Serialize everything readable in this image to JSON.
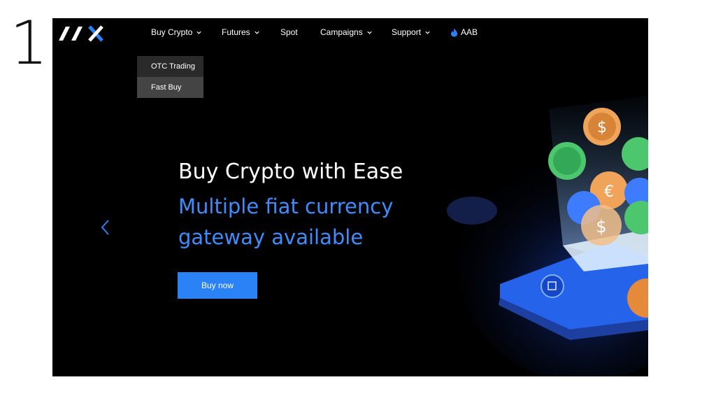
{
  "slide": {
    "number": "1"
  },
  "brand": {
    "name": "AAX"
  },
  "nav": {
    "items": [
      {
        "label": "Buy Crypto",
        "has_dropdown": true
      },
      {
        "label": "Futures",
        "has_dropdown": true
      },
      {
        "label": "Spot",
        "has_dropdown": false
      },
      {
        "label": "Campaigns",
        "has_dropdown": true
      },
      {
        "label": "Support",
        "has_dropdown": true
      },
      {
        "label": "AAB",
        "icon": "flame-icon",
        "has_dropdown": false
      }
    ]
  },
  "dropdown": {
    "items": [
      {
        "label": "OTC Trading"
      },
      {
        "label": "Fast Buy",
        "active": true
      }
    ]
  },
  "hero": {
    "title": "Buy Crypto with Ease",
    "subtitle_line1": "Multiple fiat currency",
    "subtitle_line2": "gateway available",
    "cta": "Buy now"
  },
  "colors": {
    "accent": "#2b82f6",
    "highlight_text": "#3e8dff",
    "background": "#000000"
  }
}
